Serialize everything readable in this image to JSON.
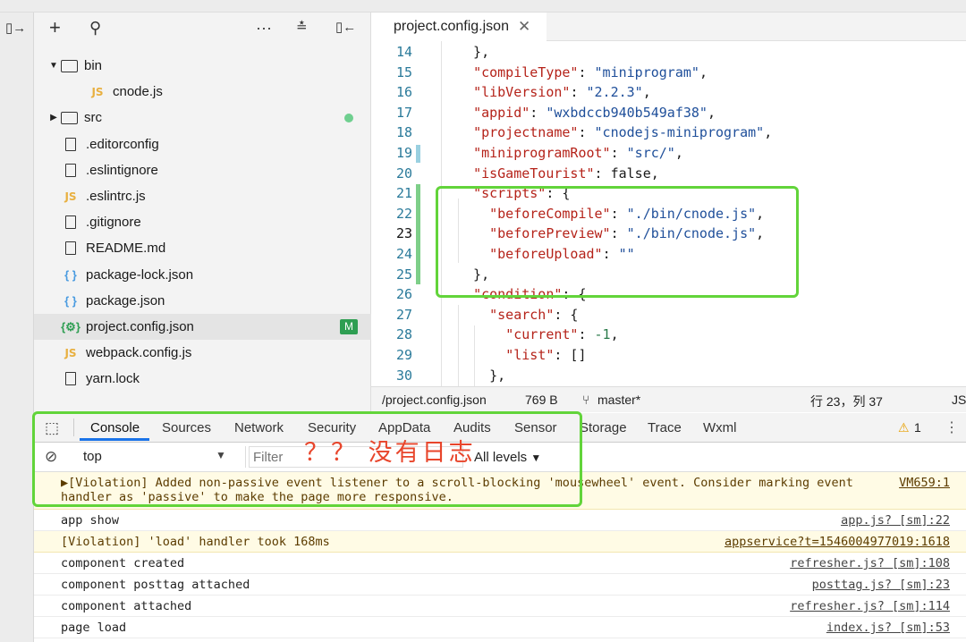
{
  "explorer": {
    "items": [
      {
        "name": "bin",
        "kind": "folder-open",
        "indent": 0
      },
      {
        "name": "cnode.js",
        "kind": "js",
        "indent": 1
      },
      {
        "name": "src",
        "kind": "folder-closed",
        "indent": 0
      },
      {
        "name": ".editorconfig",
        "kind": "doc",
        "indent": 0
      },
      {
        "name": ".eslintignore",
        "kind": "doc",
        "indent": 0
      },
      {
        "name": ".eslintrc.js",
        "kind": "js",
        "indent": 0
      },
      {
        "name": ".gitignore",
        "kind": "doc",
        "indent": 0
      },
      {
        "name": "README.md",
        "kind": "doc",
        "indent": 0
      },
      {
        "name": "package-lock.json",
        "kind": "json",
        "indent": 0
      },
      {
        "name": "package.json",
        "kind": "json",
        "indent": 0
      },
      {
        "name": "project.config.json",
        "kind": "config",
        "indent": 0,
        "selected": true,
        "badge": "M"
      },
      {
        "name": "webpack.config.js",
        "kind": "js",
        "indent": 0
      },
      {
        "name": "yarn.lock",
        "kind": "doc",
        "indent": 0
      }
    ],
    "toolbar_icons": [
      "split-icon",
      "add-icon",
      "search-icon",
      "more-icon",
      "collapse-icon",
      "panel-icon"
    ]
  },
  "editor": {
    "tab_label": "project.config.json",
    "lines": [
      {
        "n": "14",
        "code": "  },"
      },
      {
        "n": "15",
        "code": "  \"compileType\": \"miniprogram\","
      },
      {
        "n": "16",
        "code": "  \"libVersion\": \"2.2.3\","
      },
      {
        "n": "17",
        "code": "  \"appid\": \"wxbdccb940b549af38\","
      },
      {
        "n": "18",
        "code": "  \"projectname\": \"cnodejs-miniprogram\","
      },
      {
        "n": "19",
        "code": "  \"miniprogramRoot\": \"src/\","
      },
      {
        "n": "20",
        "code": "  \"isGameTourist\": false,"
      },
      {
        "n": "21",
        "code": "  \"scripts\": {"
      },
      {
        "n": "22",
        "code": "    \"beforeCompile\": \"./bin/cnode.js\","
      },
      {
        "n": "23",
        "code": "    \"beforePreview\": \"./bin/cnode.js\","
      },
      {
        "n": "24",
        "code": "    \"beforeUpload\": \"\""
      },
      {
        "n": "25",
        "code": "  },"
      },
      {
        "n": "26",
        "code": "  \"condition\": {"
      },
      {
        "n": "27",
        "code": "    \"search\": {"
      },
      {
        "n": "28",
        "code": "      \"current\": -1,"
      },
      {
        "n": "29",
        "code": "      \"list\": []"
      },
      {
        "n": "30",
        "code": "    },"
      }
    ]
  },
  "statusbar": {
    "path": "/project.config.json",
    "size": "769 B",
    "branch": "master*",
    "position": "行 23，列 37",
    "lang": "JS"
  },
  "devtools": {
    "tabs": [
      "Console",
      "Sources",
      "Network",
      "Security",
      "AppData",
      "Audits",
      "Sensor",
      "Storage",
      "Trace",
      "Wxml"
    ],
    "active_tab": "Console",
    "warning_count": "1",
    "context": "top",
    "filter_placeholder": "Filter",
    "levels": "All levels",
    "logs": [
      {
        "type": "warn",
        "msg": "▶[Violation] Added non-passive event listener to a scroll-blocking 'mousewheel' event. Consider marking event",
        "msg2": "handler as 'passive' to make the page more responsive.",
        "src": "VM659:1"
      },
      {
        "type": "log",
        "msg": "app show",
        "src": "app.js? [sm]:22"
      },
      {
        "type": "warn",
        "msg": "[Violation] 'load' handler took 168ms",
        "src": "appservice?t=1546004977019:1618"
      },
      {
        "type": "log",
        "msg": "component created",
        "src": "refresher.js? [sm]:108"
      },
      {
        "type": "log",
        "msg": "component posttag attached",
        "src": "posttag.js? [sm]:23"
      },
      {
        "type": "log",
        "msg": "component attached",
        "src": "refresher.js? [sm]:114"
      },
      {
        "type": "log",
        "msg": "page load",
        "src": "index.js? [sm]:53"
      }
    ]
  },
  "annotation": "？？ 没有日志",
  "colors": {
    "highlight_box": "#62d43a",
    "annotation": "#e8452b",
    "badge": "#2e9e52",
    "key": "#b5231a",
    "string": "#1f4f9a"
  }
}
